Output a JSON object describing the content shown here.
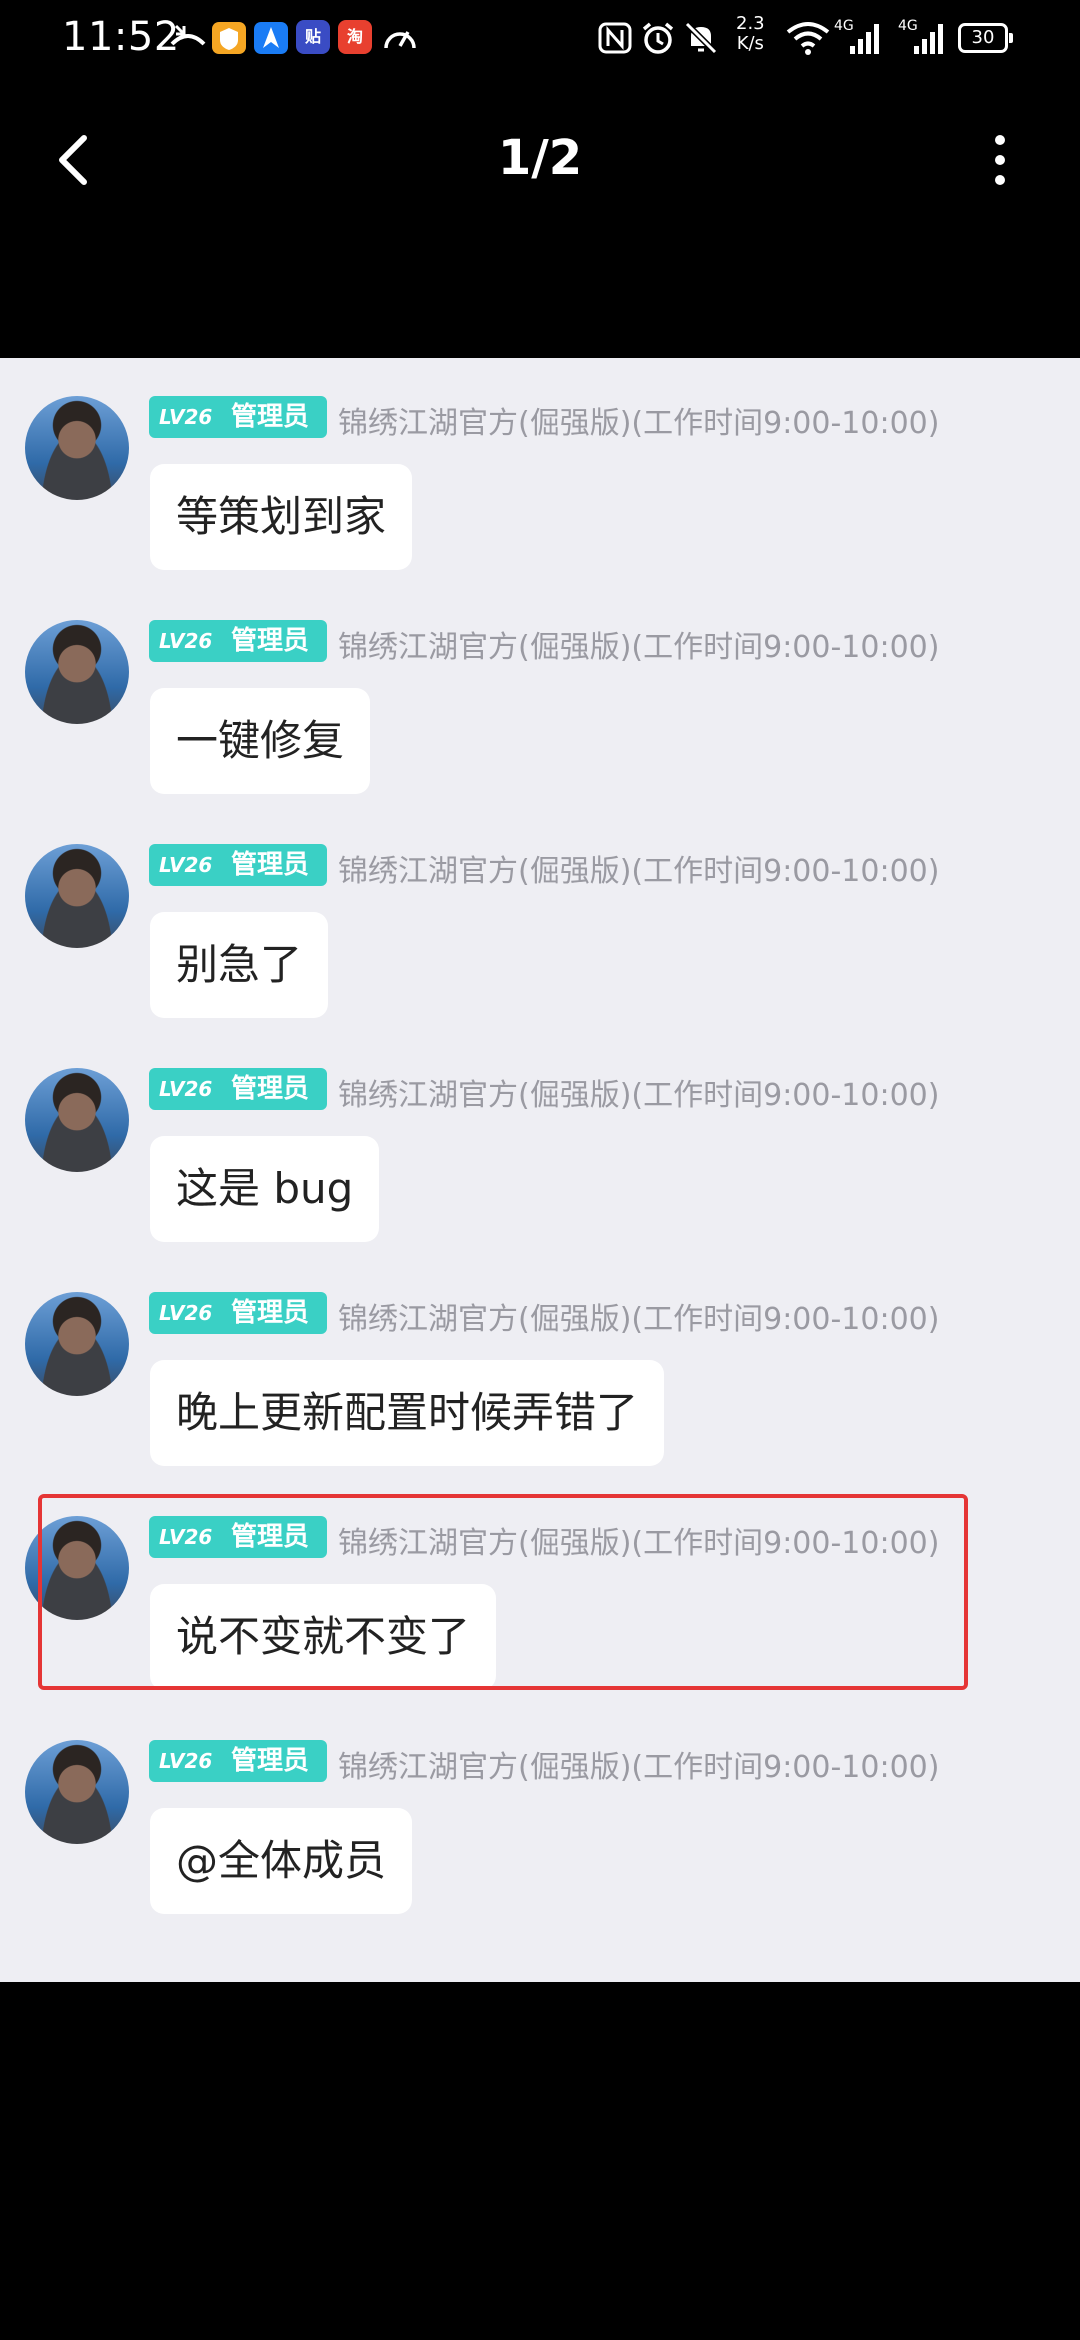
{
  "status_bar": {
    "time": "11:52",
    "net_speed_value": "2.3",
    "net_speed_unit": "K/s",
    "signal_1_label": "4G",
    "signal_2_label": "4G",
    "battery": "30",
    "app_badges": [
      {
        "name": "taobao",
        "text": "淘",
        "color": "#e8402f"
      },
      {
        "name": "tieba",
        "text": "贴",
        "color": "#3a4cc4"
      }
    ]
  },
  "nav": {
    "page_counter": "1/2"
  },
  "chat": {
    "level_text": "LV26",
    "role_text": "管理员",
    "sender_name": "锦绣江湖官方(倔强版)(工作时间9:00-10:00)",
    "messages": [
      {
        "text": "等策划到家"
      },
      {
        "text": "一键修复"
      },
      {
        "text": "别急了"
      },
      {
        "text": "这是 bug"
      },
      {
        "text": "晚上更新配置时候弄错了"
      },
      {
        "text": "说不变就不变了"
      },
      {
        "text": "@全体成员"
      }
    ]
  },
  "colors": {
    "badge": "#3ad0c5",
    "highlight": "#e53535",
    "chat_bg": "#eeeef3"
  }
}
